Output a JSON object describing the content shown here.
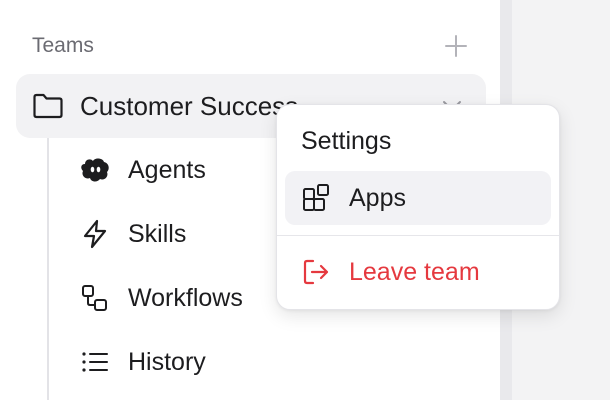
{
  "sidebar": {
    "section_title": "Teams",
    "team": {
      "name": "Customer Success"
    },
    "items": [
      {
        "label": "Agents",
        "icon": "agents-icon"
      },
      {
        "label": "Skills",
        "icon": "lightning-icon"
      },
      {
        "label": "Workflows",
        "icon": "workflow-icon"
      },
      {
        "label": "History",
        "icon": "list-icon"
      }
    ]
  },
  "menu": {
    "settings_label": "Settings",
    "apps_label": "Apps",
    "leave_label": "Leave team"
  },
  "colors": {
    "danger": "#e5393f",
    "selected_bg": "#f2f2f5",
    "muted_text": "#6b6b72"
  }
}
